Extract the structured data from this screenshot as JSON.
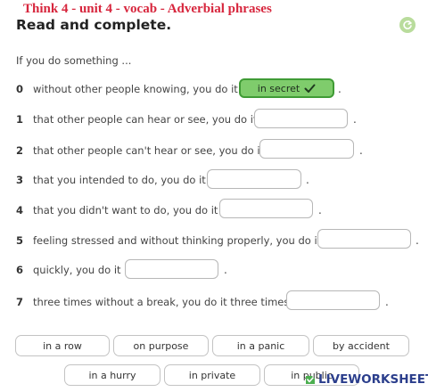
{
  "header": {
    "worksheet_title": "Think 4 - unit 4 - vocab - Adverbial phrases"
  },
  "exercise": {
    "instruction": "Read and complete.",
    "intro": "If you do something ..."
  },
  "questions": [
    {
      "num": "0",
      "text": "without other people knowing, you do it",
      "answer": "in secret"
    },
    {
      "num": "1",
      "text": "that other people can hear or see, you do it",
      "answer": ""
    },
    {
      "num": "2",
      "text": "that other people can't hear or see, you do it",
      "answer": ""
    },
    {
      "num": "3",
      "text": "that you intended to do, you do it",
      "answer": ""
    },
    {
      "num": "4",
      "text": "that you didn't want to do, you do it",
      "answer": ""
    },
    {
      "num": "5",
      "text": "feeling stressed and without thinking properly, you do it",
      "answer": ""
    },
    {
      "num": "6",
      "text": "quickly, you do it",
      "answer": ""
    },
    {
      "num": "7",
      "text": "three times without a break, you do it three times",
      "answer": ""
    }
  ],
  "punctuation": ".",
  "word_bank": [
    "in a row",
    "on purpose",
    "in a panic",
    "by accident",
    "in a hurry",
    "in private",
    "in public"
  ],
  "branding": {
    "logo_text": "LIVEWORKSHEETS"
  },
  "icons": {
    "check": "check-icon",
    "refresh": "refresh-icon",
    "logo": "liveworksheets-logo-icon"
  },
  "colors": {
    "header_red": "#d7263d",
    "correct_fill": "#7fcc6c",
    "correct_border": "#3f9b35",
    "brand_blue": "#2b3e8c"
  }
}
